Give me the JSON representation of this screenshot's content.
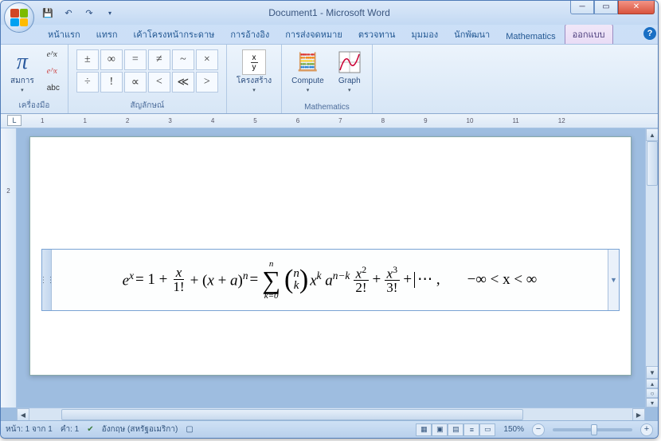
{
  "title": "Document1 - Microsoft Word",
  "tabs": [
    "หน้าแรก",
    "แทรก",
    "เค้าโครงหน้ากระดาษ",
    "การอ้างอิง",
    "การส่งจดหมาย",
    "ตรวจทาน",
    "มุมมอง",
    "นักพัฒนา",
    "Mathematics",
    "ออกแบบ"
  ],
  "activeTab": 9,
  "ribbon": {
    "tools": {
      "label": "เครื่องมือ",
      "equation_btn": "สมการ",
      "small": [
        "e^x",
        "e^x",
        "abc"
      ]
    },
    "symbols": {
      "label": "สัญลักษณ์",
      "grid": [
        "±",
        "∞",
        "=",
        "≠",
        "~",
        "×",
        "÷",
        "!",
        "∝",
        "<",
        "≪",
        ">"
      ]
    },
    "structures": {
      "label": "",
      "btn": "โครงสร้าง"
    },
    "mathematics": {
      "label": "Mathematics",
      "compute": "Compute",
      "graph": "Graph"
    }
  },
  "ruler_h": [
    "1",
    "⊤",
    "1",
    "2",
    "3",
    "4",
    "5",
    "6",
    "7",
    "8",
    "9",
    "10",
    "11",
    "12"
  ],
  "ruler_v": [
    "",
    "2",
    "",
    ""
  ],
  "equation": {
    "lhs": "e",
    "eq": " = 1 + ",
    "f1": {
      "n": "x",
      "d": "1!"
    },
    "plus1": " + (x + a)",
    "exp_n": "n",
    "eq2": " = ",
    "sum": {
      "top": "n",
      "bot": "k=0"
    },
    "binom": {
      "n": "n",
      "k": "k"
    },
    "mid": " x",
    "exp_k": "k",
    "mid2": " a",
    "exp_nk": "n−k",
    "f2": {
      "n": "x",
      "exp": "2",
      "d": "2!"
    },
    "plus2": " + ",
    "f3": {
      "n": "x",
      "exp": "3",
      "d": "3!"
    },
    "plus3": " + ",
    "dots": "⋯ ,",
    "range": "−∞ < x < ∞"
  },
  "status": {
    "page": "หน้า: 1 จาก 1",
    "words": "คำ: 1",
    "lang": "อังกฤษ (สหรัฐอเมริกา)",
    "zoom": "150%"
  }
}
